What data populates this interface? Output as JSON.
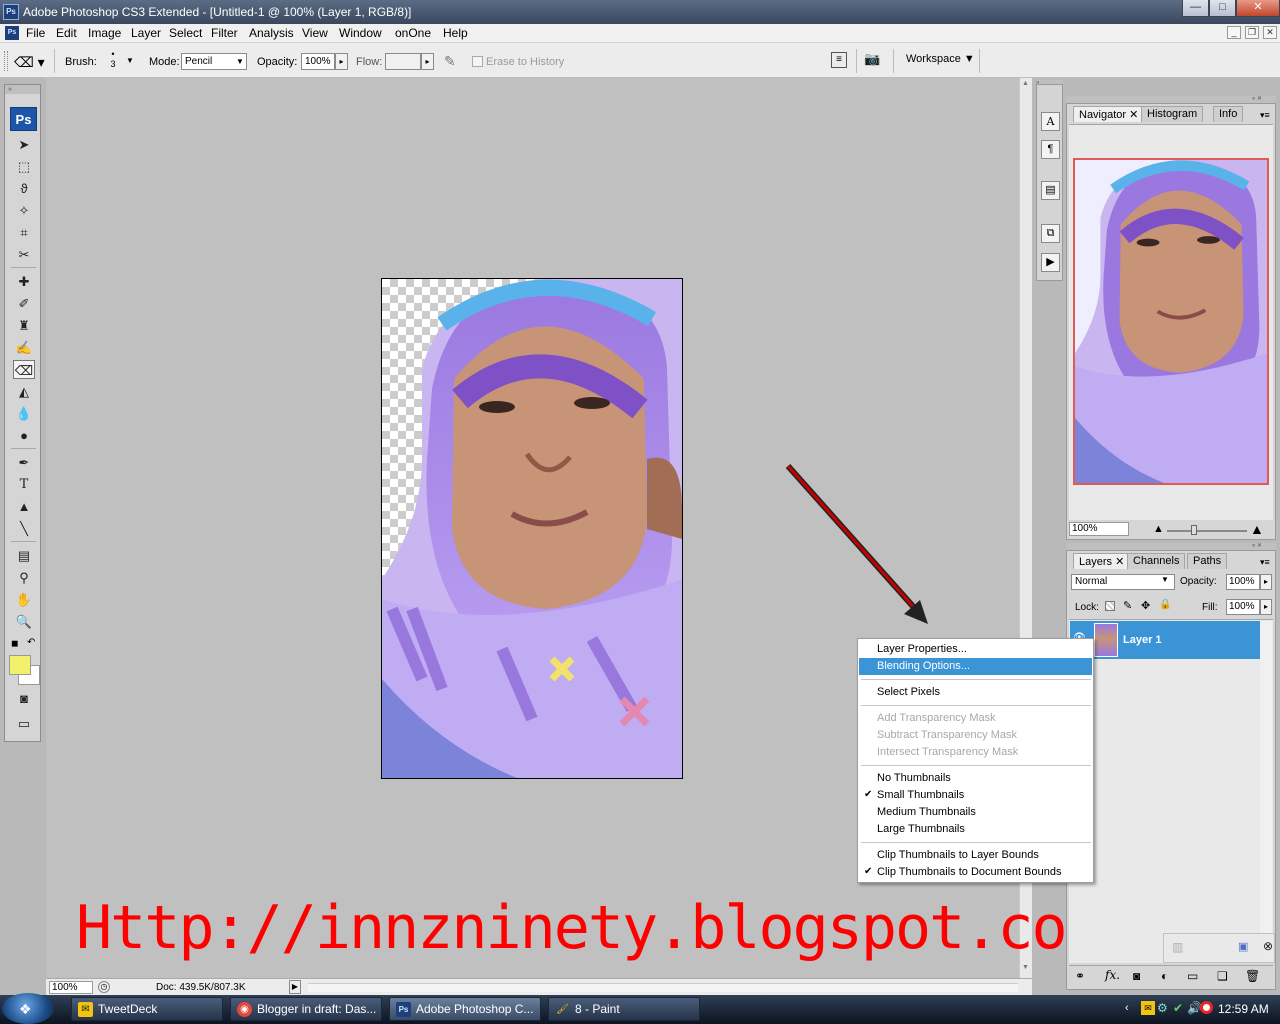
{
  "window": {
    "title": "Adobe Photoshop CS3 Extended - [Untitled-1 @ 100% (Layer 1, RGB/8)]",
    "app_icon": "Ps",
    "controls": {
      "minimize": "—",
      "maximize": "□",
      "close": "✕"
    }
  },
  "menubar": {
    "items": [
      "File",
      "Edit",
      "Image",
      "Layer",
      "Select",
      "Filter",
      "Analysis",
      "View",
      "Window",
      "onOne",
      "Help"
    ]
  },
  "options": {
    "brush_label": "Brush:",
    "brush_size": "3",
    "mode_label": "Mode:",
    "mode_value": "Pencil",
    "opacity_label": "Opacity:",
    "opacity_value": "100%",
    "flow_label": "Flow:",
    "flow_value": "",
    "erase_history_label": "Erase to History",
    "workspace_label": "Workspace"
  },
  "toolbox": {
    "logo": "Ps",
    "foreground_color": "#f3f06b",
    "background_color": "#ffffff"
  },
  "status": {
    "zoom": "100%",
    "doc_info": "Doc: 439.5K/807.3K"
  },
  "watermark_text": "Http://innzninety.blogspot.com",
  "navigator": {
    "tabs": [
      "Navigator",
      "Histogram",
      "Info"
    ],
    "zoom": "100%"
  },
  "layers": {
    "tabs": [
      "Layers",
      "Channels",
      "Paths"
    ],
    "blend_mode": "Normal",
    "opacity_label": "Opacity:",
    "opacity_value": "100%",
    "lock_label": "Lock:",
    "fill_label": "Fill:",
    "fill_value": "100%",
    "layer_name": "Layer 1"
  },
  "context_menu": {
    "items": [
      {
        "label": "Layer Properties...",
        "state": "normal"
      },
      {
        "label": "Blending Options...",
        "state": "highlighted"
      },
      {
        "label": "Select Pixels",
        "state": "normal"
      },
      {
        "label": "Add Transparency Mask",
        "state": "disabled"
      },
      {
        "label": "Subtract Transparency Mask",
        "state": "disabled"
      },
      {
        "label": "Intersect Transparency Mask",
        "state": "disabled"
      },
      {
        "label": "No Thumbnails",
        "state": "normal"
      },
      {
        "label": "Small Thumbnails",
        "state": "checked"
      },
      {
        "label": "Medium Thumbnails",
        "state": "normal"
      },
      {
        "label": "Large Thumbnails",
        "state": "normal"
      },
      {
        "label": "Clip Thumbnails to Layer Bounds",
        "state": "normal"
      },
      {
        "label": "Clip Thumbnails to Document Bounds",
        "state": "checked"
      }
    ]
  },
  "taskbar": {
    "tasks": [
      {
        "label": "TweetDeck",
        "icon": "tweetdeck-icon"
      },
      {
        "label": "Blogger in draft: Das...",
        "icon": "chrome-icon"
      },
      {
        "label": "Adobe Photoshop C...",
        "icon": "photoshop-icon"
      },
      {
        "label": "8 - Paint",
        "icon": "paint-icon"
      }
    ],
    "clock": "12:59 AM"
  },
  "colors": {
    "accent_highlight": "#3b94d6",
    "arrow": "#c40000",
    "watermark": "#ff0000",
    "navigator_frame": "#e05a5a"
  }
}
